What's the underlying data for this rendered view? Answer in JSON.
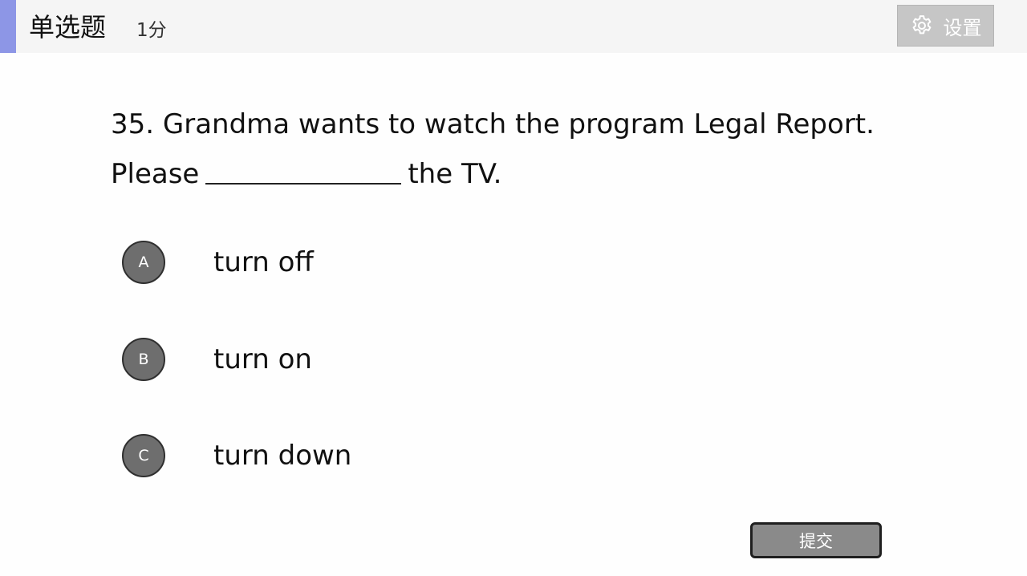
{
  "header": {
    "title": "单选题",
    "score": "1分",
    "settings_label": "设置",
    "settings_icon": "gear-icon",
    "accent_color": "#8d96e6"
  },
  "question": {
    "line1": "35. Grandma wants to watch the program Legal Report.",
    "line2_before": "Please",
    "line2_after": "the TV."
  },
  "options": [
    {
      "letter": "A",
      "text": "turn off"
    },
    {
      "letter": "B",
      "text": "turn on"
    },
    {
      "letter": "C",
      "text": "turn down"
    }
  ],
  "submit_label": "提交"
}
